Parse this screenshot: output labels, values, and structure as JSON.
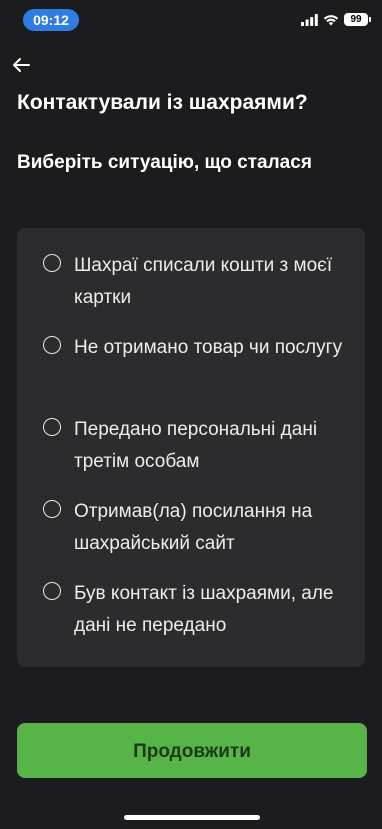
{
  "status_bar": {
    "time": "09:12",
    "battery": "99",
    "icons": [
      "signal-icon",
      "wifi-icon",
      "battery-icon"
    ]
  },
  "header": {
    "back_icon": "arrow-left-icon",
    "title": "Контактували із шахраями?"
  },
  "question": {
    "subtitle": "Виберіть ситуацію, що сталася"
  },
  "options": [
    {
      "label": "Шахраї списали кошти з моєї картки",
      "selected": false
    },
    {
      "label": "Не отримано товар чи послугу",
      "selected": false
    },
    {
      "label": "Передано персональні дані третім особам",
      "selected": false
    },
    {
      "label": "Отримав(ла) посилання на шахрайський сайт",
      "selected": false
    },
    {
      "label": "Був контакт із шахраями, але дані не передано",
      "selected": false
    }
  ],
  "actions": {
    "continue_label": "Продовжити"
  },
  "colors": {
    "background": "#1c1c1e",
    "card": "#2c2c2e",
    "accent_green": "#57b547",
    "time_pill": "#2f7de1"
  }
}
